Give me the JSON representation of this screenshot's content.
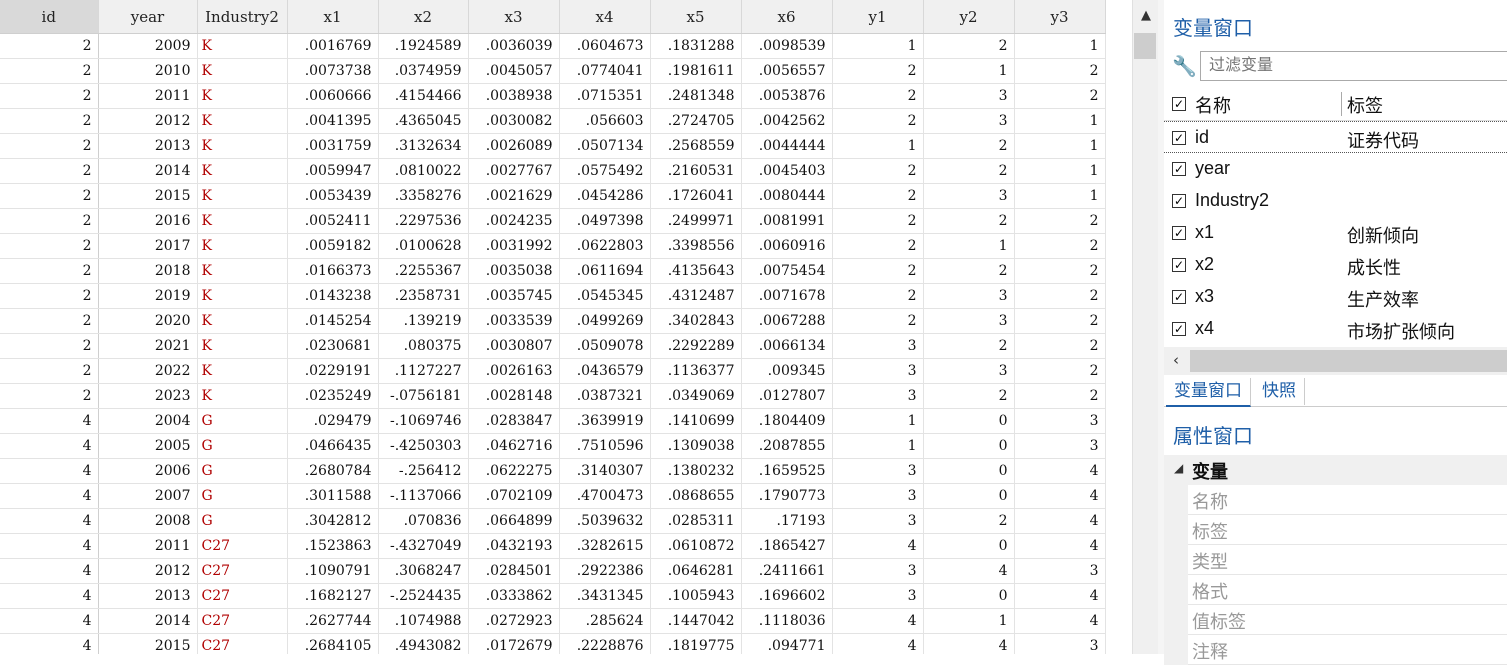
{
  "grid": {
    "columns": [
      "id",
      "year",
      "Industry2",
      "x1",
      "x2",
      "x3",
      "x4",
      "x5",
      "x6",
      "y1",
      "y2",
      "y3"
    ],
    "rows": [
      [
        "2",
        "2009",
        "K",
        ".0016769",
        ".1924589",
        ".0036039",
        ".0604673",
        ".1831288",
        ".0098539",
        "1",
        "2",
        "1"
      ],
      [
        "2",
        "2010",
        "K",
        ".0073738",
        ".0374959",
        ".0045057",
        ".0774041",
        ".1981611",
        ".0056557",
        "2",
        "1",
        "2"
      ],
      [
        "2",
        "2011",
        "K",
        ".0060666",
        ".4154466",
        ".0038938",
        ".0715351",
        ".2481348",
        ".0053876",
        "2",
        "3",
        "2"
      ],
      [
        "2",
        "2012",
        "K",
        ".0041395",
        ".4365045",
        ".0030082",
        ".056603",
        ".2724705",
        ".0042562",
        "2",
        "3",
        "1"
      ],
      [
        "2",
        "2013",
        "K",
        ".0031759",
        ".3132634",
        ".0026089",
        ".0507134",
        ".2568559",
        ".0044444",
        "1",
        "2",
        "1"
      ],
      [
        "2",
        "2014",
        "K",
        ".0059947",
        ".0810022",
        ".0027767",
        ".0575492",
        ".2160531",
        ".0045403",
        "2",
        "2",
        "1"
      ],
      [
        "2",
        "2015",
        "K",
        ".0053439",
        ".3358276",
        ".0021629",
        ".0454286",
        ".1726041",
        ".0080444",
        "2",
        "3",
        "1"
      ],
      [
        "2",
        "2016",
        "K",
        ".0052411",
        ".2297536",
        ".0024235",
        ".0497398",
        ".2499971",
        ".0081991",
        "2",
        "2",
        "2"
      ],
      [
        "2",
        "2017",
        "K",
        ".0059182",
        ".0100628",
        ".0031992",
        ".0622803",
        ".3398556",
        ".0060916",
        "2",
        "1",
        "2"
      ],
      [
        "2",
        "2018",
        "K",
        ".0166373",
        ".2255367",
        ".0035038",
        ".0611694",
        ".4135643",
        ".0075454",
        "2",
        "2",
        "2"
      ],
      [
        "2",
        "2019",
        "K",
        ".0143238",
        ".2358731",
        ".0035745",
        ".0545345",
        ".4312487",
        ".0071678",
        "2",
        "3",
        "2"
      ],
      [
        "2",
        "2020",
        "K",
        ".0145254",
        ".139219",
        ".0033539",
        ".0499269",
        ".3402843",
        ".0067288",
        "2",
        "3",
        "2"
      ],
      [
        "2",
        "2021",
        "K",
        ".0230681",
        ".080375",
        ".0030807",
        ".0509078",
        ".2292289",
        ".0066134",
        "3",
        "2",
        "2"
      ],
      [
        "2",
        "2022",
        "K",
        ".0229191",
        ".1127227",
        ".0026163",
        ".0436579",
        ".1136377",
        ".009345",
        "3",
        "3",
        "2"
      ],
      [
        "2",
        "2023",
        "K",
        ".0235249",
        "-.0756181",
        ".0028148",
        ".0387321",
        ".0349069",
        ".0127807",
        "3",
        "2",
        "2"
      ],
      [
        "4",
        "2004",
        "G",
        ".029479",
        "-.1069746",
        ".0283847",
        ".3639919",
        ".1410699",
        ".1804409",
        "1",
        "0",
        "3"
      ],
      [
        "4",
        "2005",
        "G",
        ".0466435",
        "-.4250303",
        ".0462716",
        ".7510596",
        ".1309038",
        ".2087855",
        "1",
        "0",
        "3"
      ],
      [
        "4",
        "2006",
        "G",
        ".2680784",
        "-.256412",
        ".0622275",
        ".3140307",
        ".1380232",
        ".1659525",
        "3",
        "0",
        "4"
      ],
      [
        "4",
        "2007",
        "G",
        ".3011588",
        "-.1137066",
        ".0702109",
        ".4700473",
        ".0868655",
        ".1790773",
        "3",
        "0",
        "4"
      ],
      [
        "4",
        "2008",
        "G",
        ".3042812",
        ".070836",
        ".0664899",
        ".5039632",
        ".0285311",
        ".17193",
        "3",
        "2",
        "4"
      ],
      [
        "4",
        "2011",
        "C27",
        ".1523863",
        "-.4327049",
        ".0432193",
        ".3282615",
        ".0610872",
        ".1865427",
        "4",
        "0",
        "4"
      ],
      [
        "4",
        "2012",
        "C27",
        ".1090791",
        ".3068247",
        ".0284501",
        ".2922386",
        ".0646281",
        ".2411661",
        "3",
        "4",
        "3"
      ],
      [
        "4",
        "2013",
        "C27",
        ".1682127",
        "-.2524435",
        ".0333862",
        ".3431345",
        ".1005943",
        ".1696602",
        "3",
        "0",
        "4"
      ],
      [
        "4",
        "2014",
        "C27",
        ".2627744",
        ".1074988",
        ".0272923",
        ".285624",
        ".1447042",
        ".1118036",
        "4",
        "1",
        "4"
      ],
      [
        "4",
        "2015",
        "C27",
        ".2684105",
        ".4943082",
        ".0172679",
        ".2228876",
        ".1819775",
        ".094771",
        "4",
        "4",
        "3"
      ]
    ]
  },
  "variables_window": {
    "title": "变量窗口",
    "filter_placeholder": "过滤变量",
    "header_name": "名称",
    "header_label": "标签",
    "items": [
      {
        "name": "id",
        "label": "证券代码"
      },
      {
        "name": "year",
        "label": ""
      },
      {
        "name": "Industry2",
        "label": ""
      },
      {
        "name": "x1",
        "label": "创新倾向"
      },
      {
        "name": "x2",
        "label": "成长性"
      },
      {
        "name": "x3",
        "label": "生产效率"
      },
      {
        "name": "x4",
        "label": "市场扩张倾向"
      }
    ]
  },
  "tabs": [
    "变量窗口",
    "快照"
  ],
  "properties_window": {
    "title": "属性窗口",
    "section": "变量",
    "fields": [
      "名称",
      "标签",
      "类型",
      "格式",
      "值标签",
      "注释"
    ]
  },
  "colors": {
    "accent": "#1f5fa8",
    "string_value": "#b00000",
    "header_bg": "#f0f0f0"
  },
  "icons": {
    "filter": "wrench-icon",
    "scroll_up": "chevron-up-icon",
    "scroll_left": "chevron-left-icon"
  }
}
